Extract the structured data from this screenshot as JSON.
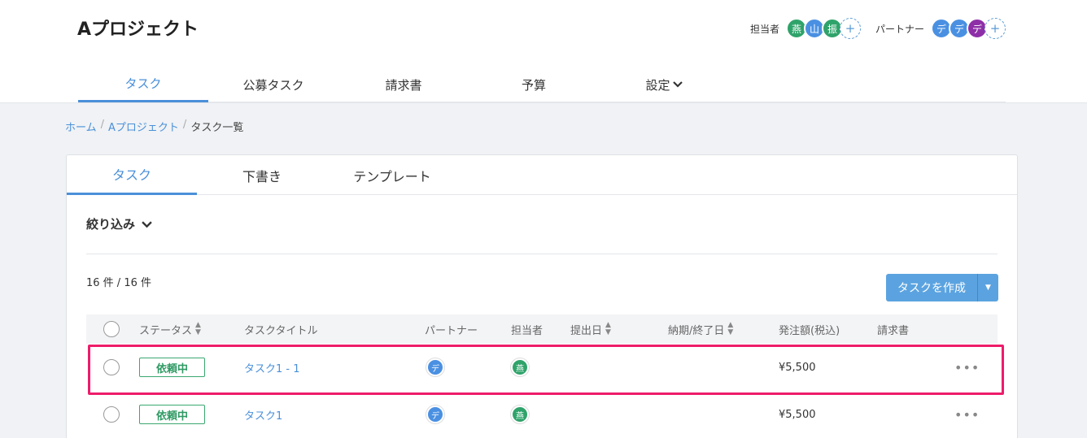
{
  "project": {
    "title": "Aプロジェクト",
    "assignee_label": "担当者",
    "partner_label": "パートナー",
    "assignees": [
      {
        "initial": "燕",
        "color": "#2fa36a"
      },
      {
        "initial": "山",
        "color": "#4a90e2"
      },
      {
        "initial": "振",
        "color": "#2fa36a"
      }
    ],
    "partners": [
      {
        "initial": "デ",
        "color": "#4a90e2"
      },
      {
        "initial": "デ",
        "color": "#4a90e2"
      },
      {
        "initial": "デ",
        "color": "#8e2fa8"
      }
    ],
    "add_symbol": "+"
  },
  "nav": {
    "tabs": [
      "タスク",
      "公募タスク",
      "請求書",
      "予算",
      "設定"
    ],
    "active_index": 0
  },
  "breadcrumb": {
    "home": "ホーム",
    "project": "Aプロジェクト",
    "current": "タスク一覧"
  },
  "subtabs": {
    "tabs": [
      "タスク",
      "下書き",
      "テンプレート"
    ],
    "active_index": 0
  },
  "filter_label": "絞り込み",
  "count_text": "16 件 / 16 件",
  "create_button": "タスクを作成",
  "table": {
    "headers": {
      "status": "ステータス",
      "title": "タスクタイトル",
      "partner": "パートナー",
      "assignee": "担当者",
      "submitted": "提出日",
      "deadline": "納期/終了日",
      "amount": "発注額(税込)",
      "invoice": "請求書"
    },
    "rows": [
      {
        "status": "依頼中",
        "title": "タスク1 - 1",
        "partner": "デ",
        "assignee": "燕",
        "amount": "¥5,500",
        "more": "•••"
      },
      {
        "status": "依頼中",
        "title": "タスク1",
        "partner": "デ",
        "assignee": "燕",
        "amount": "¥5,500",
        "more": "•••"
      }
    ]
  },
  "colors": {
    "accent": "#4a90d9",
    "status_green": "#2e9a63",
    "highlight": "#ee1c6a"
  }
}
